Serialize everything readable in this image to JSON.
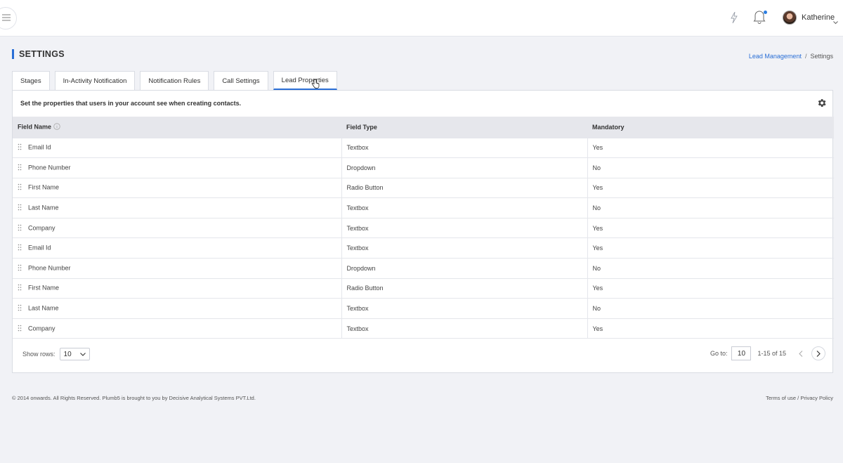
{
  "header": {
    "menu_icon": "hamburger-icon",
    "quick_icon": "bolt-icon",
    "notification_icon": "bell-icon",
    "user_name": "Katherine"
  },
  "page": {
    "title": "SETTINGS",
    "breadcrumb": {
      "link": "Lead Management",
      "separator": "/",
      "current": "Settings"
    }
  },
  "tabs": [
    {
      "label": "Stages"
    },
    {
      "label": "In-Activity Notification"
    },
    {
      "label": "Notification Rules"
    },
    {
      "label": "Call Settings"
    },
    {
      "label": "Lead Properties",
      "active": true
    }
  ],
  "panel": {
    "description": "Set the properties that users in your account see when creating contacts."
  },
  "table": {
    "columns": [
      "Field Name",
      "Field Type",
      "Mandatory"
    ],
    "rows": [
      {
        "name": "Email Id",
        "type": "Textbox",
        "mandatory": "Yes"
      },
      {
        "name": "Phone Number",
        "type": "Dropdown",
        "mandatory": "No"
      },
      {
        "name": "First Name",
        "type": "Radio Button",
        "mandatory": "Yes"
      },
      {
        "name": "Last Name",
        "type": "Textbox",
        "mandatory": "No"
      },
      {
        "name": "Company",
        "type": "Textbox",
        "mandatory": "Yes"
      },
      {
        "name": "Email Id",
        "type": "Textbox",
        "mandatory": "Yes"
      },
      {
        "name": "Phone Number",
        "type": "Dropdown",
        "mandatory": "No"
      },
      {
        "name": "First Name",
        "type": "Radio Button",
        "mandatory": "Yes"
      },
      {
        "name": "Last Name",
        "type": "Textbox",
        "mandatory": "No"
      },
      {
        "name": "Company",
        "type": "Textbox",
        "mandatory": "Yes"
      }
    ]
  },
  "pagination": {
    "show_rows_label": "Show rows:",
    "rows_value": "10",
    "goto_label": "Go to:",
    "goto_value": "10",
    "range": "1-15 of 15"
  },
  "footer": {
    "copyright": "© 2014 onwards. All Rights Reserved. Plumb5 is brought to you by Decisive Analytical Systems PVT.Ltd.",
    "links": "Terms of use / Privacy Policy"
  },
  "colors": {
    "accent": "#2a6fd6",
    "background": "#f1f2f6",
    "table_header": "#e6e7ec"
  }
}
